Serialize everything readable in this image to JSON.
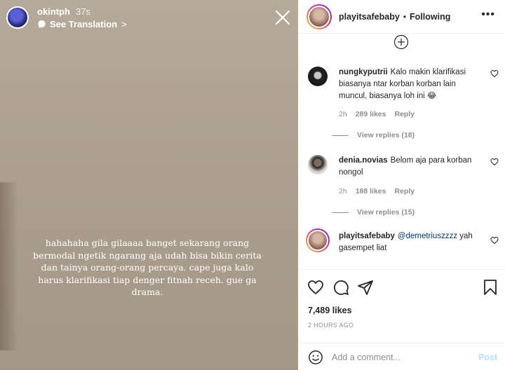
{
  "story": {
    "username": "okintph",
    "time": "37s",
    "translation_label": "See Translation",
    "translation_chevron": ">",
    "caption": "hahahaha gila gilaaaa banget sekarang orang bermodal ngetik ngarang aja udah bisa bikin cerita dan tainya orang-orang percaya. cape juga kalo harus klarifikasi tiap denger fitnah receh. gue ga drama."
  },
  "post": {
    "username": "playitsafebaby",
    "separator": "•",
    "follow_status": "Following",
    "more": "•••"
  },
  "comments": [
    {
      "username": "nungkyputrii",
      "text": "Kalo makin klarifikasi biasanya ntar korban korban lain muncul, biasanya loh ini 😂",
      "time": "2h",
      "likes": "289 likes",
      "reply": "Reply",
      "view_replies": "View replies (18)"
    },
    {
      "username": "denia.novias",
      "text": "Belom aja para korban nongol",
      "time": "2h",
      "likes": "188 likes",
      "reply": "Reply",
      "view_replies": "View replies (15)"
    },
    {
      "username": "playitsafebaby",
      "mention": "@demetriuszzzz",
      "text": "yah gasempet liat"
    }
  ],
  "likes_count": "7,489 likes",
  "timestamp": "2 HOURS AGO",
  "comment_box": {
    "placeholder": "Add a comment...",
    "post_label": "Post"
  }
}
